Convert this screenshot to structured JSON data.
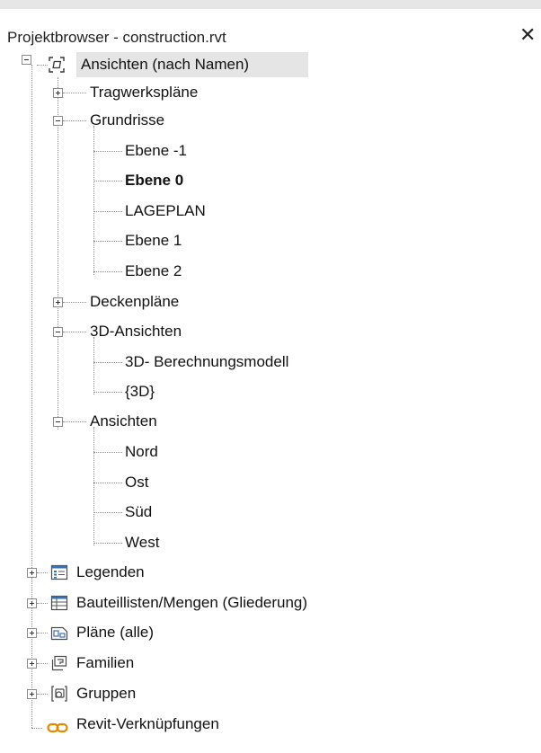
{
  "window": {
    "title": "Projektbrowser - construction.rvt",
    "close_symbol": "✕"
  },
  "tree": {
    "root_label": "Ansichten (nach Namen)",
    "views": {
      "tragwerksplaene": "Tragwerkspläne",
      "grundrisse": "Grundrisse",
      "grundrisse_items": [
        "Ebene -1",
        "Ebene 0",
        "LAGEPLAN",
        "Ebene 1",
        "Ebene 2"
      ],
      "deckenplaene": "Deckenpläne",
      "ansichten_3d": "3D-Ansichten",
      "ansichten_3d_items": [
        "3D- Berechnungsmodell",
        "{3D}"
      ],
      "ansichten": "Ansichten",
      "ansichten_items": [
        "Nord",
        "Ost",
        "Süd",
        "West"
      ]
    },
    "categories": {
      "legenden": "Legenden",
      "bauteillisten": "Bauteillisten/Mengen (Gliederung)",
      "plaene": "Pläne (alle)",
      "familien": "Familien",
      "gruppen": "Gruppen",
      "revit_links": "Revit-Verknüpfungen"
    },
    "active_view": "Ebene 0",
    "selected_node": "Ansichten (nach Namen)"
  },
  "icons": {
    "root": "views-icon",
    "legenden": "legend-icon",
    "bauteillisten": "schedule-icon",
    "plaene": "sheet-icon",
    "familien": "family-icon",
    "gruppen": "group-icon",
    "revit_links": "link-icon"
  },
  "colors": {
    "selection": "#e5e5e5",
    "link_icon": "#e08a00",
    "icon_blue": "#3a6fb0"
  }
}
